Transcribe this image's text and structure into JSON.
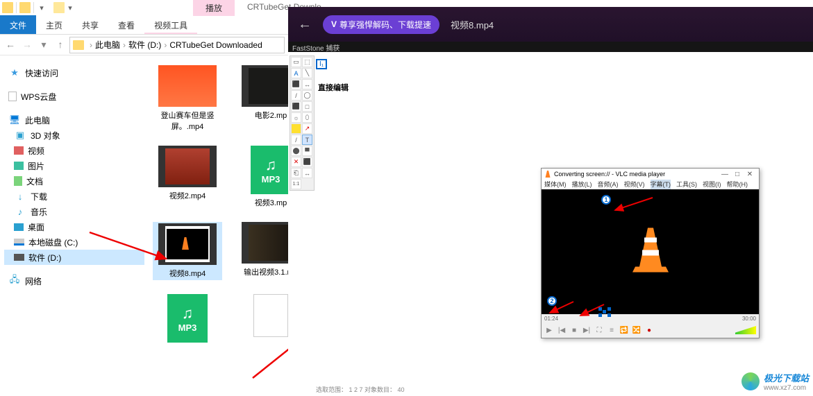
{
  "titlebar": {
    "play_tab": "播放",
    "app_title": "CRTubeGet Downlo"
  },
  "ribbon": {
    "file": "文件",
    "home": "主页",
    "share": "共享",
    "view": "查看",
    "video_tools": "视频工具"
  },
  "breadcrumb": {
    "pc": "此电脑",
    "drive": "软件 (D:)",
    "folder": "CRTubeGet Downloaded"
  },
  "sidebar": {
    "quick": "快速访问",
    "wps": "WPS云盘",
    "pc": "此电脑",
    "obj3d": "3D 对象",
    "videos": "视频",
    "pictures": "图片",
    "documents": "文档",
    "downloads": "下载",
    "music": "音乐",
    "desktop": "桌面",
    "cdrive": "本地磁盘 (C:)",
    "ddrive": "软件 (D:)",
    "network": "网络"
  },
  "files": {
    "f1": "登山赛车但是竖屏。.mp4",
    "f2": "电影2.mp",
    "f3": "视频2.mp4",
    "f4": "视频3.mp",
    "mp3label": "MP3",
    "f5": "视频8.mp4",
    "f6": "输出视频3.1.mp"
  },
  "player": {
    "badge_text": "尊享强悍解码、下载提速",
    "title": "视频8.mp4"
  },
  "faststone": {
    "title": "FastStone 捕获",
    "edit_text": "直接编辑",
    "cursor_text": "I₁"
  },
  "fs_tools": [
    "▭",
    "⬚",
    "A",
    "╲",
    "⬛",
    "↔",
    "/",
    "◯",
    "⬛",
    "□",
    "☼",
    "⬯",
    "⬆",
    "/",
    "T",
    "⬚",
    "▀",
    "✕",
    "⬛",
    "⎗",
    "↔",
    "1:1"
  ],
  "vlc": {
    "title": "Converting screen:// - VLC media player",
    "menu": [
      "媒体(M)",
      "播放(L)",
      "音频(A)",
      "视频(V)",
      "字幕(T)",
      "工具(S)",
      "视图(I)",
      "帮助(H)"
    ],
    "num1": "1",
    "num2": "2",
    "time_left": "01:24",
    "time_right": "30:00"
  },
  "watermark": {
    "name": "极光下载站",
    "url": "www.xz7.com"
  },
  "status": "选取范围： 1 2 7    对象数目： 40"
}
